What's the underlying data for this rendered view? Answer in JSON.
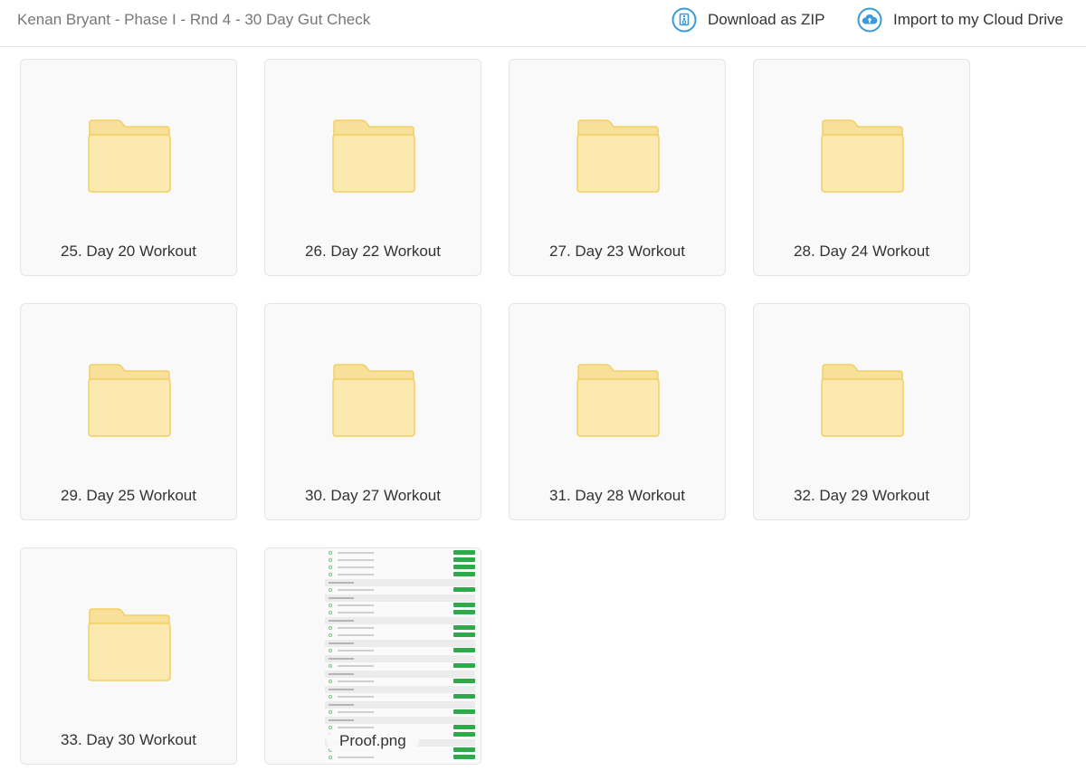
{
  "header": {
    "title": "Kenan Bryant - Phase I - Rnd 4 - 30 Day Gut Check",
    "download_label": "Download as ZIP",
    "import_label": "Import to my Cloud Drive",
    "download_icon": "zip-download-icon",
    "import_icon": "cloud-upload-icon",
    "accent_color": "#3a9ad9"
  },
  "items": [
    {
      "type": "folder",
      "name": "25. Day 20 Workout"
    },
    {
      "type": "folder",
      "name": "26. Day 22 Workout"
    },
    {
      "type": "folder",
      "name": "27. Day 23 Workout"
    },
    {
      "type": "folder",
      "name": "28. Day 24 Workout"
    },
    {
      "type": "folder",
      "name": "29. Day 25 Workout"
    },
    {
      "type": "folder",
      "name": "30. Day 27 Workout"
    },
    {
      "type": "folder",
      "name": "31. Day 28 Workout"
    },
    {
      "type": "folder",
      "name": "32. Day 29 Workout"
    },
    {
      "type": "folder",
      "name": "33. Day 30 Workout"
    },
    {
      "type": "image",
      "name": "Proof.png"
    }
  ],
  "colors": {
    "folder_body": "#fbe9b0",
    "folder_tab": "#f8e09a",
    "folder_edge": "#efcf66",
    "thumb_button": "#2eaa4a"
  }
}
